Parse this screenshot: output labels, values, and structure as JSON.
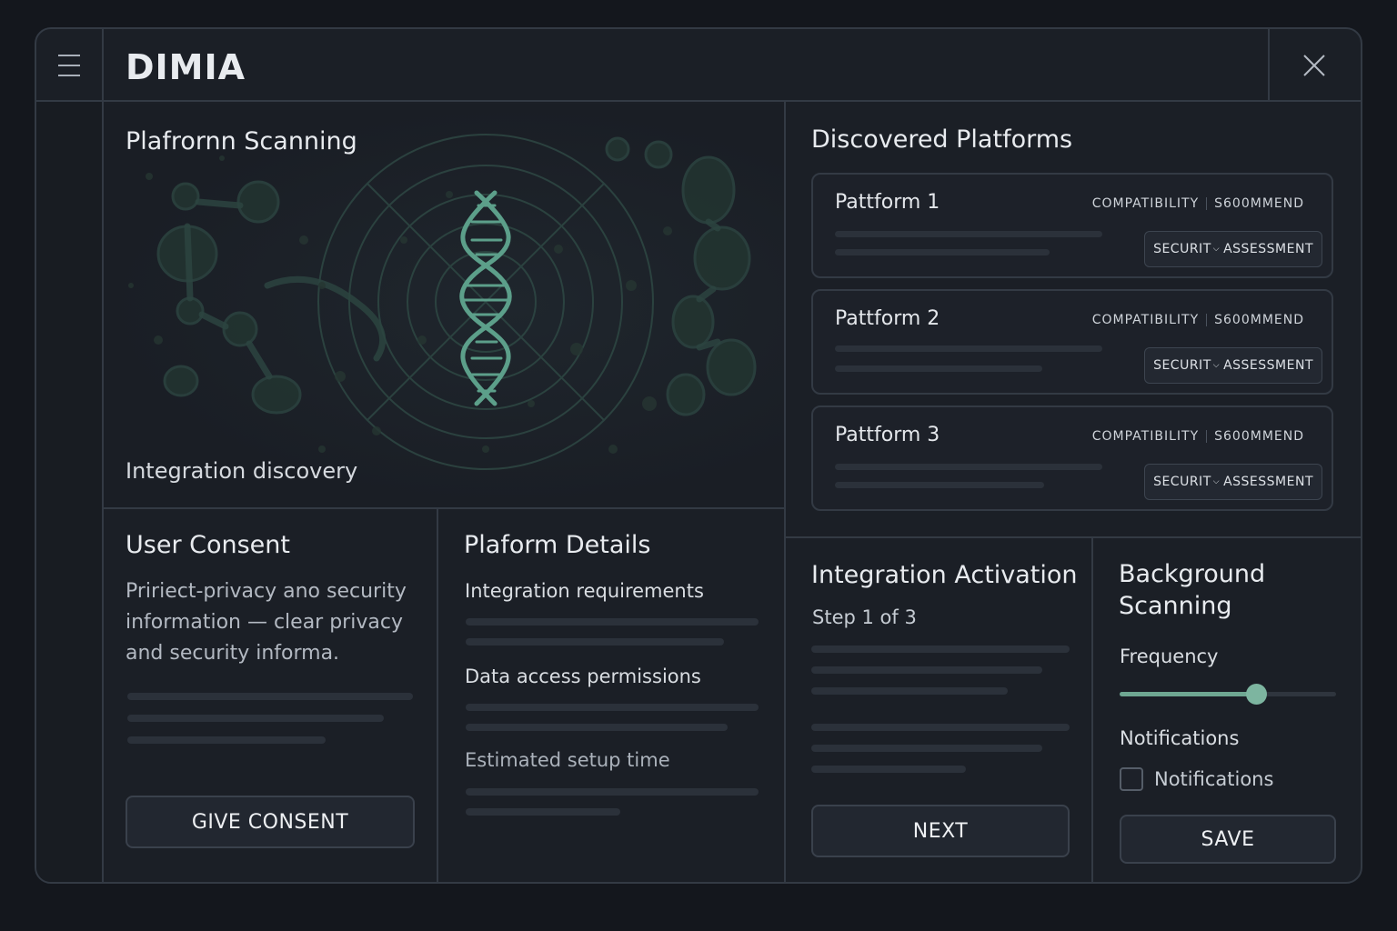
{
  "app": {
    "title": "DIMIA"
  },
  "scan": {
    "title": "Plafrornn Scanning",
    "caption": "Integration discovery"
  },
  "discovered": {
    "title": "Discovered Platforms",
    "platforms": [
      {
        "name": "Pattform 1",
        "compatibility": "COMPATIBILITY",
        "recommend": "S600MMEND",
        "security": "SECURIT",
        "assessment": "ASSESSMENT"
      },
      {
        "name": "Pattform 2",
        "compatibility": "COMPATIBILITY",
        "recommend": "S600MMEND",
        "security": "SECURIT",
        "assessment": "ASSESSMENT"
      },
      {
        "name": "Pattform 3",
        "compatibility": "COMPATIBILITY",
        "recommend": "S600MMEND",
        "security": "SECURIT",
        "assessment": "ASSESSMENT"
      }
    ]
  },
  "consent": {
    "title": "User Consent",
    "line1": "Pririect-privacy ano security",
    "line2": "information  — clear privacy",
    "line3": "and security informa.",
    "button": "GIVE CONSENT"
  },
  "details": {
    "title": "Plaform Details",
    "req": "Integration requirements",
    "perm": "Data access permissions",
    "time": "Estimated setup time"
  },
  "activation": {
    "title": "Integration Activation",
    "step": "Step 1 of 3",
    "button": "NEXT"
  },
  "background": {
    "title_line1": "Background",
    "title_line2": "Scanning",
    "frequency_label": "Frequency",
    "frequency_value": 0.63,
    "notifications_label": "Notifications",
    "notifications_checkbox": "Notifications",
    "notifications_checked": false,
    "button": "SAVE"
  },
  "colors": {
    "accent": "#7db5a0",
    "background": "#14171d",
    "panel": "#1b1f26",
    "border": "#333a44"
  },
  "icons": {
    "menu": "hamburger-menu-icon",
    "close": "close-icon",
    "scan_art": "dna-helix-icon",
    "chevron": "chevron-down-icon"
  }
}
